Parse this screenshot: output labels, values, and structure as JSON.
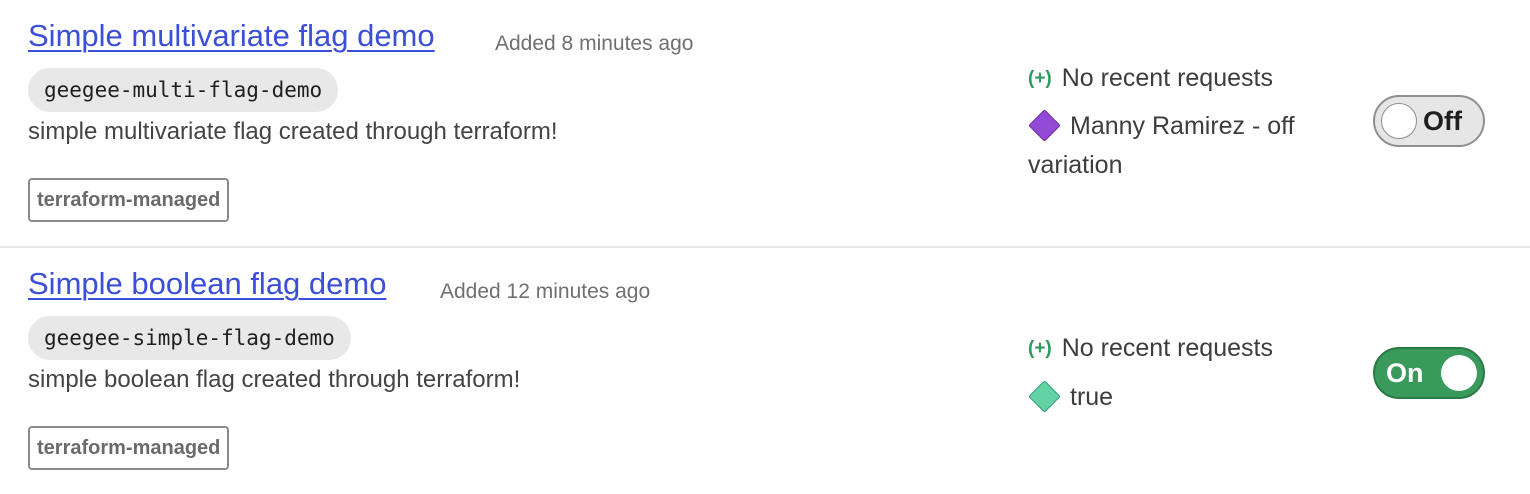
{
  "flags": [
    {
      "name": "Simple multivariate flag demo",
      "added": "Added 8 minutes ago",
      "key": "geegee-multi-flag-demo",
      "description": "simple multivariate flag created through terraform!",
      "tag": "terraform-managed",
      "requests_icon": "(+)",
      "requests_label": "No recent requests",
      "variation_icon": "diamond-icon",
      "variation_color": "#9149d6",
      "variation": "Manny Ramirez - off variation",
      "toggle_state": "off",
      "toggle_label": "Off"
    },
    {
      "name": "Simple boolean flag demo",
      "added": "Added 12 minutes ago",
      "key": "geegee-simple-flag-demo",
      "description": "simple boolean flag created through terraform!",
      "tag": "terraform-managed",
      "requests_icon": "(+)",
      "requests_label": "No recent requests",
      "variation_icon": "diamond-icon",
      "variation_color": "#63d3a6",
      "variation": "true",
      "toggle_state": "on",
      "toggle_label": "On"
    }
  ],
  "colors": {
    "link": "#3b4fd8",
    "toggle_on": "#3a9a5c",
    "toggle_off": "#e6e6e6",
    "requests_icon": "#2e9a5e"
  }
}
